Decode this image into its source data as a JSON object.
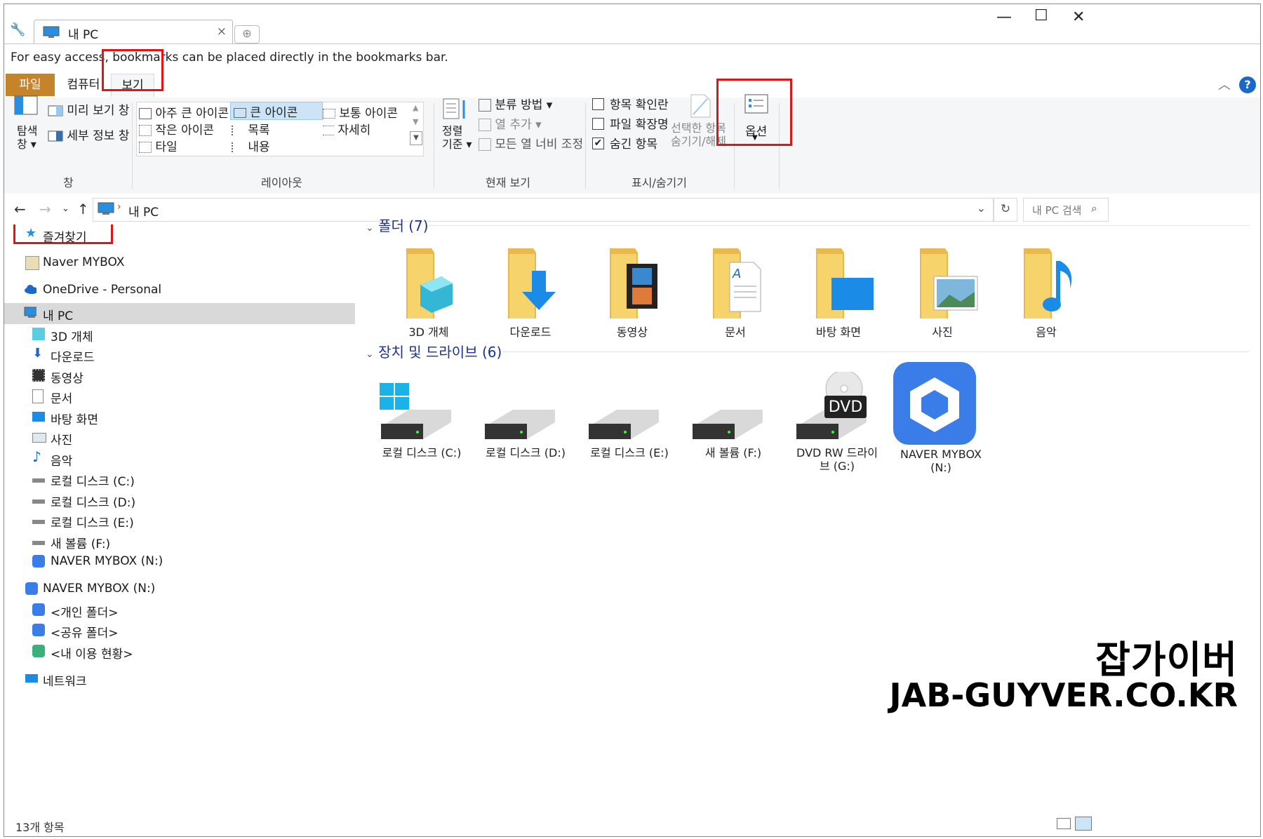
{
  "browser": {
    "tab_title": "내 PC",
    "bookmark_hint": "For easy access, bookmarks can be placed directly in the bookmarks bar."
  },
  "ribbon_tabs": {
    "file": "파일",
    "computer": "컴퓨터",
    "view": "보기"
  },
  "ribbon": {
    "pane": {
      "nav_pane": "탐색\n창 ▾",
      "preview": "미리 보기 창",
      "details": "세부 정보 창",
      "label": "창"
    },
    "layout": {
      "items": [
        "아주 큰 아이콘",
        "큰 아이콘",
        "보통 아이콘",
        "작은 아이콘",
        "목록",
        "자세히",
        "타일",
        "내용"
      ],
      "selected": "큰 아이콘",
      "label": "레이아웃"
    },
    "current_view": {
      "sort": "정렬\n기준 ▾",
      "group": "분류 방법 ▾",
      "add_col": "열 추가 ▾",
      "fit_cols": "모든 열 너비 조정",
      "label": "현재 보기"
    },
    "show_hide": {
      "item_checkbox": "항목 확인란",
      "item_checkbox_checked": false,
      "file_ext": "파일 확장명",
      "file_ext_checked": false,
      "hidden_items": "숨긴 항목",
      "hidden_items_checked": true,
      "hide_selected": "선택한 항목\n숨기기/해제",
      "label": "표시/숨기기"
    },
    "options": "옵션"
  },
  "address": {
    "path": "내 PC",
    "search_placeholder": "내 PC 검색"
  },
  "nav": {
    "favorites": "즐겨찾기",
    "naver_mybox_top": "Naver MYBOX",
    "onedrive": "OneDrive - Personal",
    "this_pc": "내 PC",
    "pc_items": [
      "3D 개체",
      "다운로드",
      "동영상",
      "문서",
      "바탕 화면",
      "사진",
      "음악",
      "로컬 디스크 (C:)",
      "로컬 디스크 (D:)",
      "로컬 디스크 (E:)",
      "새 볼륨 (F:)",
      "NAVER MYBOX (N:)"
    ],
    "naver_mybox_drive": "NAVER MYBOX (N:)",
    "mybox_items": [
      "<개인 폴더>",
      "<공유 폴더>",
      "<내 이용 현황>"
    ],
    "network": "네트워크"
  },
  "content": {
    "folders_header": "폴더 (7)",
    "folders": [
      "3D 개체",
      "다운로드",
      "동영상",
      "문서",
      "바탕 화면",
      "사진",
      "음악"
    ],
    "drives_header": "장치 및 드라이브 (6)",
    "drives": [
      "로컬 디스크 (C:)",
      "로컬 디스크 (D:)",
      "로컬 디스크 (E:)",
      "새 볼륨 (F:)",
      "DVD RW 드라이\n브 (G:)",
      "NAVER MYBOX\n(N:)"
    ],
    "dvd_badge": "DVD"
  },
  "status": {
    "count": "13개 항목"
  },
  "watermark": {
    "line1": "잡가이버",
    "line2": "JAB-GUYVER.CO.KR"
  },
  "colors": {
    "accent_red": "#e01515",
    "file_tab": "#c5842a",
    "folder_yellow": "#f6d36b",
    "header_blue": "#1e3287"
  }
}
